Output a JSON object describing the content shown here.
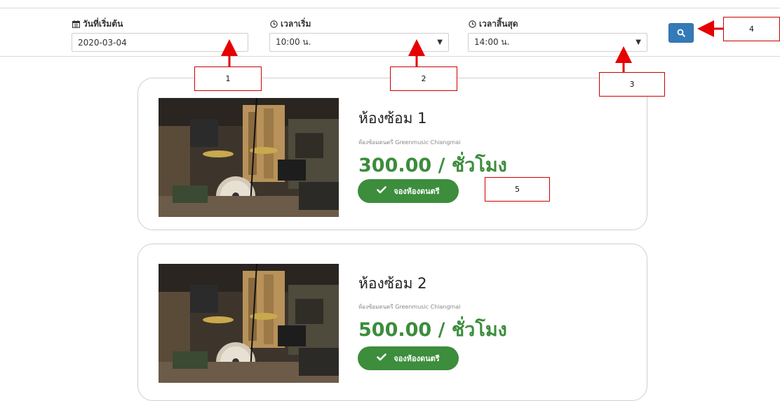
{
  "filters": {
    "start_date": {
      "label": "วันที่เริ่มต้น",
      "value": "2020-03-04"
    },
    "start_time": {
      "label": "เวลาเริ่ม",
      "value": "10:00 น."
    },
    "end_time": {
      "label": "เวลาสิ้นสุด",
      "value": "14:00 น."
    }
  },
  "search_button": {
    "icon": "search-icon"
  },
  "callouts": [
    "1",
    "2",
    "3",
    "4",
    "5"
  ],
  "rooms": [
    {
      "title": "ห้องซ้อม 1",
      "venue": "ห้องซ้อมดนตรี Greenmusic Chiangmai",
      "price": "300.00 / ชั่วโมง",
      "book_label": "จองห้องดนตรี"
    },
    {
      "title": "ห้องซ้อม 2",
      "venue": "ห้องซ้อมดนตรี Greenmusic Chiangmai",
      "price": "500.00 / ชั่วโมง",
      "book_label": "จองห้องดนตรี"
    }
  ],
  "colors": {
    "accent_green": "#3c8d3c",
    "search_blue": "#337ab7",
    "callout_red": "#cc0000"
  }
}
